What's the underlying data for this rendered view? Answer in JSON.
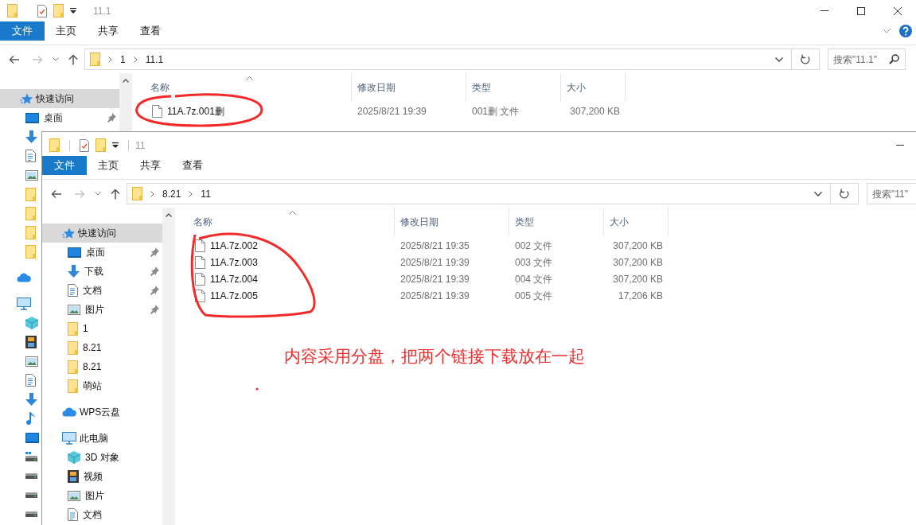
{
  "back_window": {
    "title": "11.1",
    "toolbar_dividers": false,
    "ribbon": [
      {
        "label": "文件",
        "kind": "file_menu"
      },
      {
        "label": "主页",
        "kind": "tab"
      },
      {
        "label": "共享",
        "kind": "tab"
      },
      {
        "label": "查看",
        "kind": "tab"
      }
    ],
    "path": [
      "1",
      "11.1"
    ],
    "search": {
      "placeholder": "搜索\"11.1\""
    },
    "sidebar": [
      {
        "label": "快速访问",
        "kind": "star",
        "selected": true,
        "children": [
          {
            "label": "桌面",
            "kind": "desktop",
            "pinned": true,
            "selected": false
          },
          {
            "kind": "download",
            "pinned": false,
            "selected": false
          },
          {
            "kind": "document",
            "pinned": false,
            "selected": false
          },
          {
            "kind": "picture",
            "pinned": false,
            "selected": false
          },
          {
            "kind": "folder",
            "pinned": false,
            "selected": false
          },
          {
            "kind": "folder",
            "pinned": false,
            "selected": false
          },
          {
            "kind": "folder",
            "pinned": false,
            "selected": false
          },
          {
            "kind": "folder",
            "pinned": false,
            "selected": false
          }
        ]
      },
      {
        "kind": "cloud",
        "selected": false
      },
      {
        "kind": "computer",
        "selected": false,
        "children": [
          {
            "kind": "cube",
            "selected": false
          },
          {
            "kind": "film",
            "selected": false
          },
          {
            "kind": "picture",
            "selected": false
          },
          {
            "kind": "document",
            "selected": false
          },
          {
            "kind": "download",
            "selected": false
          },
          {
            "kind": "music",
            "selected": false
          },
          {
            "kind": "desktop",
            "selected": false
          },
          {
            "kind": "drive_windows",
            "selected": false
          },
          {
            "kind": "drive",
            "selected": false
          },
          {
            "kind": "drive",
            "selected": false
          },
          {
            "kind": "drive",
            "selected": false
          }
        ]
      }
    ],
    "columns": [
      "名称",
      "修改日期",
      "类型",
      "大小"
    ],
    "files": [
      {
        "name": "11A.7z.001删",
        "modified": "2025/8/21 19:39",
        "type": "001删 文件",
        "size": "307,200 KB"
      }
    ]
  },
  "front_window": {
    "title": "11",
    "toolbar_dividers": true,
    "ribbon": [
      {
        "label": "文件",
        "kind": "file_menu"
      },
      {
        "label": "主页",
        "kind": "tab"
      },
      {
        "label": "共享",
        "kind": "tab"
      },
      {
        "label": "查看",
        "kind": "tab"
      }
    ],
    "path": [
      "8.21",
      "11"
    ],
    "search": {
      "placeholder": "搜索\"11\""
    },
    "sidebar": [
      {
        "label": "快速访问",
        "kind": "star",
        "selected": true,
        "children": [
          {
            "label": "桌面",
            "kind": "desktop",
            "pinned": true,
            "selected": false
          },
          {
            "label": "下载",
            "kind": "download",
            "pinned": true,
            "selected": false
          },
          {
            "label": "文档",
            "kind": "document",
            "pinned": true,
            "selected": false
          },
          {
            "label": "图片",
            "kind": "picture",
            "pinned": true,
            "selected": false
          },
          {
            "label": "1",
            "kind": "folder",
            "pinned": false,
            "selected": false
          },
          {
            "label": "8.21",
            "kind": "folder",
            "pinned": false,
            "selected": false
          },
          {
            "label": "8.21",
            "kind": "folder",
            "pinned": false,
            "selected": false
          },
          {
            "label": "萌站",
            "kind": "folder",
            "pinned": false,
            "selected": false
          }
        ]
      },
      {
        "label": "WPS云盘",
        "kind": "cloud",
        "selected": false
      },
      {
        "label": "此电脑",
        "kind": "computer",
        "selected": false,
        "children": [
          {
            "label": "3D 对象",
            "kind": "cube",
            "selected": false
          },
          {
            "label": "视频",
            "kind": "film",
            "selected": false
          },
          {
            "label": "图片",
            "kind": "picture",
            "selected": false
          },
          {
            "label": "文档",
            "kind": "document",
            "selected": false
          }
        ]
      }
    ],
    "columns": [
      "名称",
      "修改日期",
      "类型",
      "大小"
    ],
    "files": [
      {
        "name": "11A.7z.002",
        "modified": "2025/8/21 19:35",
        "type": "002 文件",
        "size": "307,200 KB"
      },
      {
        "name": "11A.7z.003",
        "modified": "2025/8/21 19:39",
        "type": "003 文件",
        "size": "307,200 KB"
      },
      {
        "name": "11A.7z.004",
        "modified": "2025/8/21 19:39",
        "type": "004 文件",
        "size": "307,200 KB"
      },
      {
        "name": "11A.7z.005",
        "modified": "2025/8/21 19:39",
        "type": "005 文件",
        "size": "17,206 KB"
      }
    ]
  },
  "annotation": {
    "text": "内容采用分盘，把两个链接下载放在一起"
  }
}
